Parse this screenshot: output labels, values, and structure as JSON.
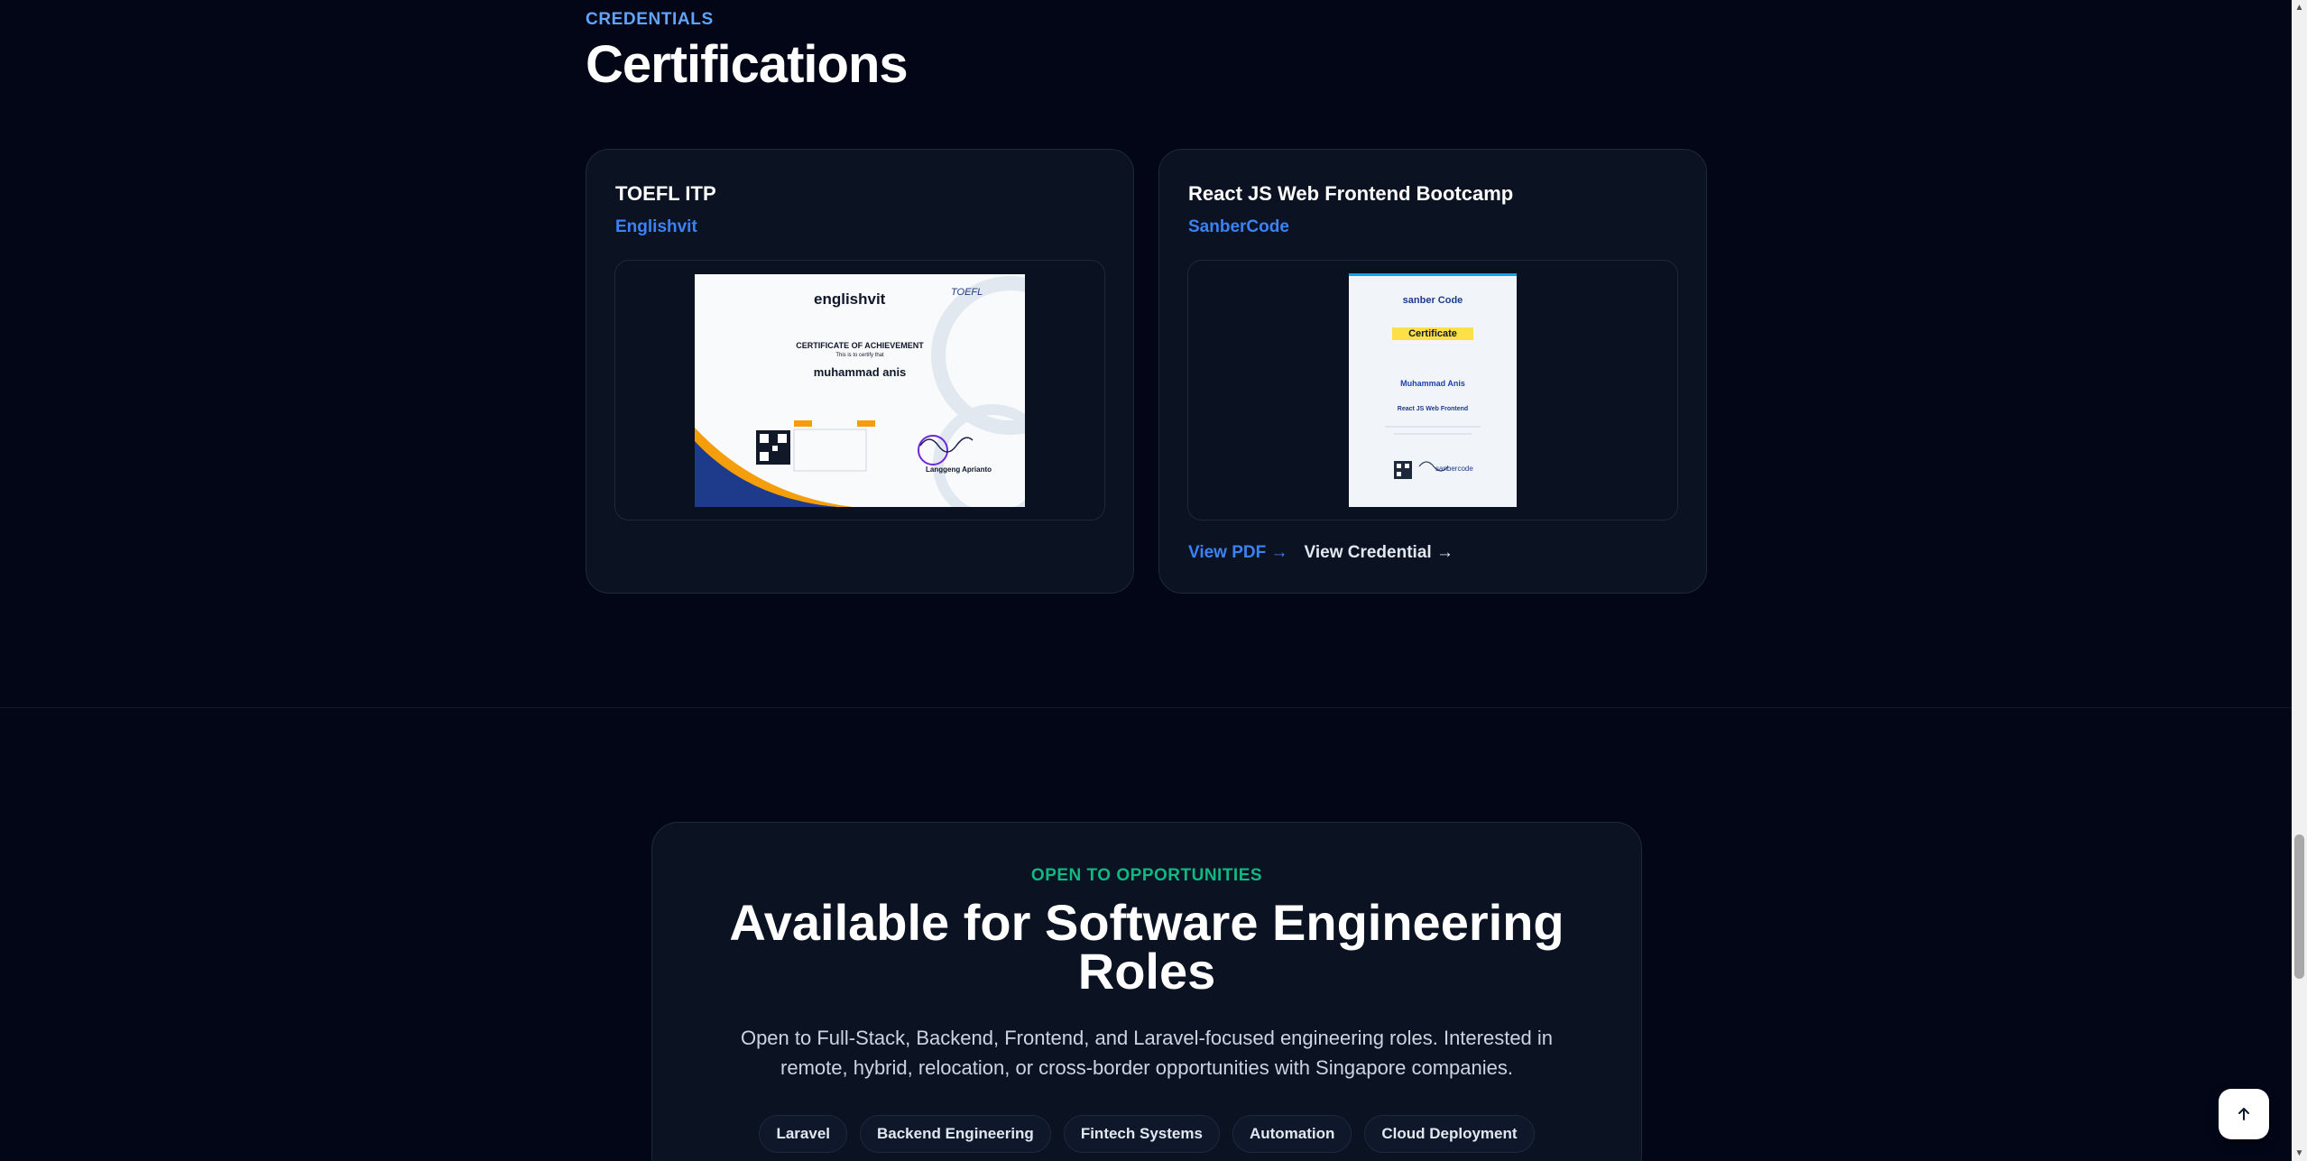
{
  "credentials": {
    "eyebrow": "CREDENTIALS",
    "title": "Certifications",
    "certs": [
      {
        "name": "TOEFL ITP",
        "issuer": "Englishvit",
        "preview": {
          "brand": "englishvit",
          "heading": "CERTIFICATE OF ACHIEVEMENT",
          "subheading": "This is to certify that",
          "recipient": "muhammad anis",
          "exam": "TOEFL",
          "signer": "Langgeng Aprianto"
        }
      },
      {
        "name": "React JS Web Frontend Bootcamp",
        "issuer": "SanberCode",
        "preview": {
          "brand": "sanber Code",
          "heading": "Certificate",
          "recipient": "Muhammad Anis",
          "course": "React JS Web Frontend",
          "footer_brand": "sanbercode"
        },
        "links": {
          "pdf": "View PDF →",
          "credential": "View Credential →"
        }
      }
    ]
  },
  "opportunities": {
    "eyebrow": "OPEN TO OPPORTUNITIES",
    "title": "Available for Software Engineering Roles",
    "description": "Open to Full-Stack, Backend, Frontend, and Laravel-focused engineering roles. Interested in remote, hybrid, relocation, or cross-border opportunities with Singapore companies.",
    "tags": [
      "Laravel",
      "Backend Engineering",
      "Fintech Systems",
      "Automation",
      "Cloud Deployment"
    ]
  },
  "scroll_progress": 0.83,
  "colors": {
    "background": "#020617",
    "card": "#0b1222",
    "accent_blue": "#3b82f6",
    "accent_green": "#10b981"
  }
}
